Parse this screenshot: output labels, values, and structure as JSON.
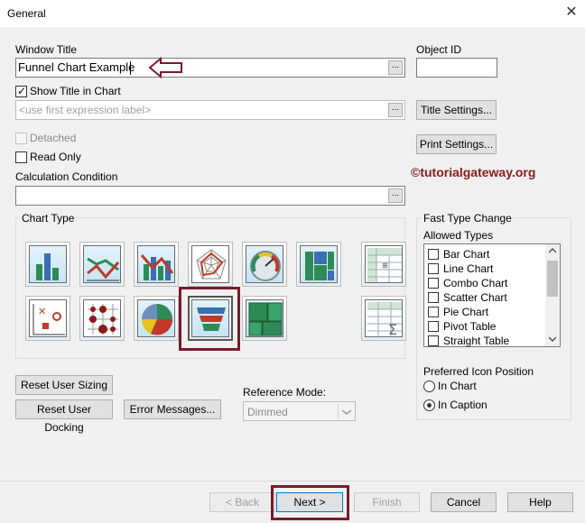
{
  "window": {
    "title": "General",
    "close_glyph": "✕"
  },
  "window_title": {
    "label": "Window Title",
    "value": "Funnel Chart Example",
    "browse": "..."
  },
  "object_id": {
    "label": "Object ID",
    "value": ""
  },
  "show_title": {
    "label": "Show Title in Chart",
    "checked": true
  },
  "title_expr": {
    "placeholder": "<use first expression label>",
    "browse": "..."
  },
  "title_settings_button": "Title Settings...",
  "print_settings_button": "Print Settings...",
  "detached": {
    "label": "Detached",
    "checked": false
  },
  "read_only": {
    "label": "Read Only",
    "checked": false
  },
  "watermark": "©tutorialgateway.org",
  "calc_condition": {
    "label": "Calculation Condition",
    "value": "",
    "browse": "..."
  },
  "chart_type": {
    "label": "Chart Type",
    "icons": [
      "bar-chart",
      "line-chart",
      "combo-chart",
      "radar-chart",
      "gauge-chart",
      "mekko-chart",
      "pivot-table",
      "scatter-chart",
      "grid-chart",
      "pie-chart",
      "funnel-chart",
      "block-chart",
      "straight-table"
    ],
    "selected": "funnel-chart"
  },
  "fast_type_change": {
    "label": "Fast Type Change",
    "allowed_label": "Allowed Types",
    "items": [
      "Bar Chart",
      "Line Chart",
      "Combo Chart",
      "Scatter Chart",
      "Pie Chart",
      "Pivot Table",
      "Straight Table"
    ],
    "preferred_label": "Preferred Icon Position",
    "radio_in_chart": "In Chart",
    "radio_in_caption": "In Caption",
    "selected_position": "In Caption"
  },
  "reset_user_sizing_button": "Reset User Sizing",
  "reset_user_docking_button": "Reset User Docking",
  "error_messages_button": "Error Messages...",
  "reference_mode": {
    "label": "Reference Mode:",
    "value": "Dimmed"
  },
  "footer": {
    "back": "< Back",
    "next": "Next >",
    "finish": "Finish",
    "cancel": "Cancel",
    "help": "Help"
  },
  "colors": {
    "highlight": "#7b1a2a",
    "watermark": "#8b1a1a"
  }
}
